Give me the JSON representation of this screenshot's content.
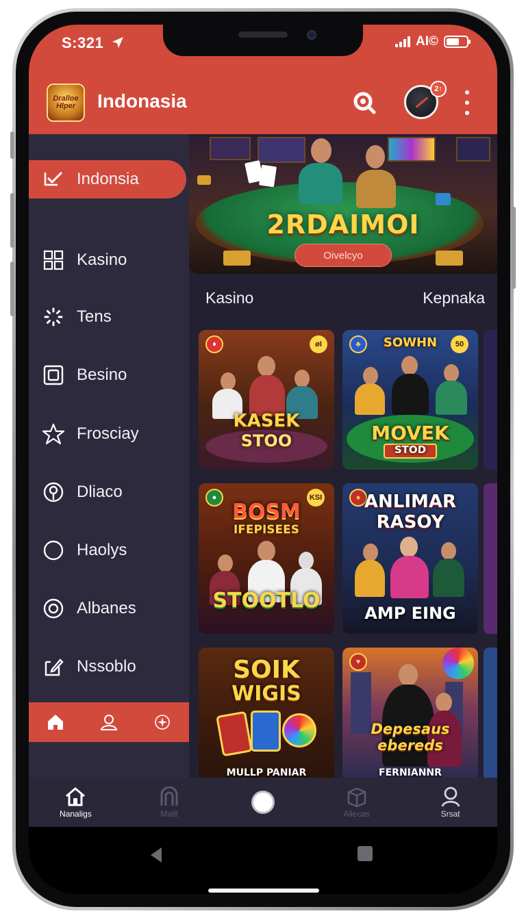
{
  "status_bar": {
    "time": "S:321",
    "wifi_text": "AI©",
    "icons": [
      "navigation-arrow-icon",
      "signal-icon",
      "wifi-icon",
      "battery-icon"
    ]
  },
  "header": {
    "logo_text": "Dralloe Hlper",
    "title": "Indonasia",
    "avatar_badge": "2↑",
    "icons": [
      "search-icon",
      "profile-avatar",
      "more-icon"
    ]
  },
  "sidebar": {
    "items": [
      {
        "label": "Indonsia",
        "icon": "check-icon",
        "active": true
      },
      {
        "label": "Kasino",
        "icon": "grid-icon",
        "active": false
      },
      {
        "label": "Tens",
        "icon": "loading-icon",
        "active": false
      },
      {
        "label": "Besino",
        "icon": "square-icon",
        "active": false
      },
      {
        "label": "Frosciay",
        "icon": "star-icon",
        "active": false
      },
      {
        "label": "Dliaco",
        "icon": "chip-icon",
        "active": false
      },
      {
        "label": "Haolys",
        "icon": "moon-icon",
        "active": false
      },
      {
        "label": "Albanes",
        "icon": "target-icon",
        "active": false
      },
      {
        "label": "Nssoblo",
        "icon": "edit-icon",
        "active": false
      }
    ],
    "bottom_icons": [
      "home-icon",
      "user-icon",
      "settings-icon"
    ]
  },
  "banner": {
    "title": "2RDAIMOI",
    "button_label": "Oivelcyo"
  },
  "section": {
    "left": "Kasino",
    "right": "Kepnaka"
  },
  "cards": [
    {
      "title_line1": "KASEK",
      "title_line2": "STOO",
      "chip": "øI"
    },
    {
      "title_line1": "SOWHN",
      "title_line2": "MOVEK",
      "title_line3": "STOD",
      "chip": "50"
    },
    {
      "title_line1": "BOSM",
      "title_line2": "IFEPISEES",
      "title_line3": "STOOTLO",
      "chip": "KSI"
    },
    {
      "title_line1": "ANLIMAR",
      "title_line2": "RASOY",
      "title_line3": "AMP EING"
    },
    {
      "title_line1": "SOIK",
      "title_line2": "WIGIS",
      "caption": "MULLP PANIAR"
    },
    {
      "title_line1": "Depesaus",
      "title_line2": "ebereds",
      "caption": "FERNIANNR"
    }
  ],
  "bottom_nav": [
    {
      "label": "Nanaligs",
      "icon": "home-icon",
      "state": "active"
    },
    {
      "label": "Mallt",
      "icon": "arch-icon",
      "state": "dim"
    },
    {
      "label": "",
      "icon": "home-circle-button",
      "state": "center"
    },
    {
      "label": "Allecas",
      "icon": "box-icon",
      "state": "dim"
    },
    {
      "label": "Srsat",
      "icon": "person-icon",
      "state": "light"
    }
  ],
  "colors": {
    "accent": "#d24a3c",
    "sidebar": "#2e2a3e",
    "content": "#232131",
    "gold": "#ffd54a"
  }
}
